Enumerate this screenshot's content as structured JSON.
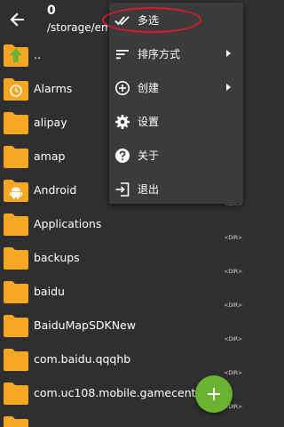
{
  "header": {
    "count": "0",
    "path": "/storage/em"
  },
  "files": [
    {
      "name": "..",
      "type": "parent",
      "tag": ""
    },
    {
      "name": "Alarms",
      "type": "alarm",
      "tag": ""
    },
    {
      "name": "alipay",
      "type": "folder",
      "tag": ""
    },
    {
      "name": "amap",
      "type": "folder",
      "tag": ""
    },
    {
      "name": "Android",
      "type": "android",
      "tag": "<DIR>"
    },
    {
      "name": "Applications",
      "type": "folder",
      "tag": "<DIR>"
    },
    {
      "name": "backups",
      "type": "folder",
      "tag": "<DIR>"
    },
    {
      "name": "baidu",
      "type": "folder",
      "tag": "<DIR>"
    },
    {
      "name": "BaiduMapSDKNew",
      "type": "folder",
      "tag": "<DIR>"
    },
    {
      "name": "com.baidu.qqqhb",
      "type": "folder",
      "tag": "<DIR>"
    },
    {
      "name": "com.uc108.mobile.gamecenter",
      "type": "folder",
      "tag": "<DIR>"
    },
    {
      "name": "",
      "type": "folder",
      "tag": ""
    }
  ],
  "menu": {
    "items": [
      {
        "label": "多选",
        "icon": "multi-select-icon",
        "submenu": false
      },
      {
        "label": "排序方式",
        "icon": "sort-icon",
        "submenu": true
      },
      {
        "label": "创建",
        "icon": "add-circle-icon",
        "submenu": true
      },
      {
        "label": "设置",
        "icon": "gear-icon",
        "submenu": false
      },
      {
        "label": "关于",
        "icon": "help-icon",
        "submenu": false
      },
      {
        "label": "退出",
        "icon": "exit-icon",
        "submenu": false
      }
    ]
  },
  "colors": {
    "background": "#2f2f2f",
    "menu": "#3b3b3b",
    "folder": "#f5a623",
    "fab": "#6ab22f",
    "annotation": "#e0162b"
  }
}
